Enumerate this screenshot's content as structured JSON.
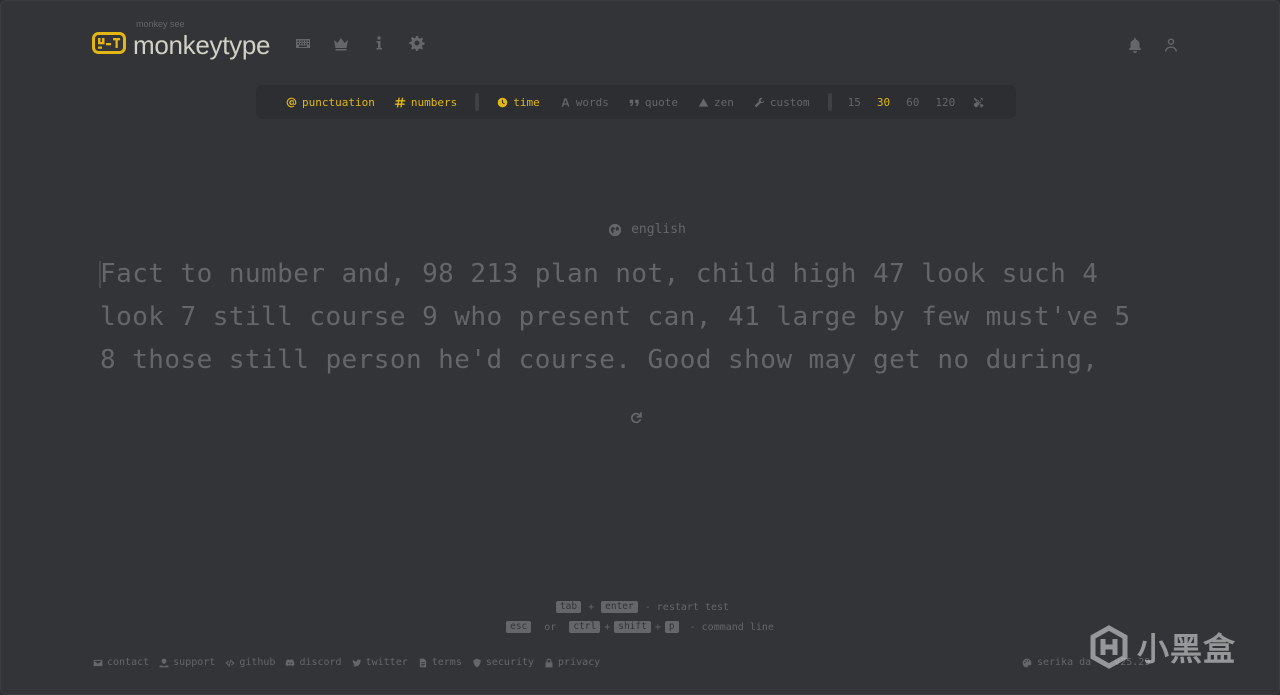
{
  "header": {
    "logo_top": "monkey see",
    "logo_name": "monkeytype",
    "nav_icons": [
      "keyboard-icon",
      "crown-icon",
      "info-icon",
      "gear-icon"
    ],
    "right_icons": [
      "bell-icon",
      "user-icon"
    ]
  },
  "config": {
    "punctuation": "punctuation",
    "numbers": "numbers",
    "time": "time",
    "words": "words",
    "quote": "quote",
    "zen": "zen",
    "custom": "custom",
    "durations": [
      "15",
      "30",
      "60",
      "120"
    ],
    "active_duration": "30",
    "accent_color": "#e2b714"
  },
  "language": "english",
  "words": {
    "lines": [
      "Fact to number and, 98 213 plan not, child high 47 look such 4",
      "look 7 still course 9 who present can, 41 large by few must've 5",
      "8 those still person he'd course. Good show may get no during,"
    ]
  },
  "hints": {
    "tab": "tab",
    "plus": "+",
    "enter": "enter",
    "restart": "- restart test",
    "esc": "esc",
    "or": "or",
    "ctrl": "ctrl",
    "shift": "shift",
    "p": "p",
    "command": "- command line"
  },
  "footer": {
    "links": [
      "contact",
      "support",
      "github",
      "discord",
      "twitter",
      "terms",
      "security",
      "privacy"
    ],
    "theme": "serika da",
    "version": "v25.29"
  },
  "watermark": "小黑盒"
}
